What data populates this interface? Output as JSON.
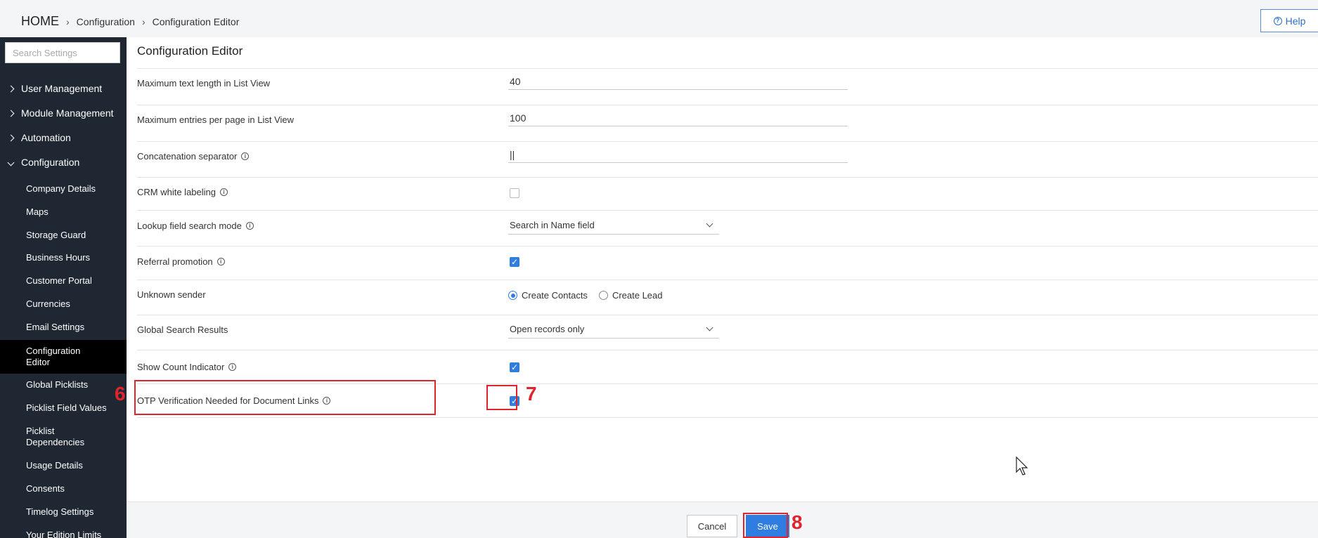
{
  "breadcrumb": {
    "home": "HOME",
    "items": [
      "Configuration",
      "Configuration Editor"
    ]
  },
  "help": {
    "label": "Help"
  },
  "sidebar": {
    "search_placeholder": "Search Settings",
    "groups": [
      {
        "label": "User Management"
      },
      {
        "label": "Module Management"
      },
      {
        "label": "Automation"
      },
      {
        "label": "Configuration"
      }
    ],
    "items": [
      {
        "label": "Company Details"
      },
      {
        "label": "Maps"
      },
      {
        "label": "Storage Guard"
      },
      {
        "label": "Business Hours"
      },
      {
        "label": "Customer Portal"
      },
      {
        "label": "Currencies"
      },
      {
        "label": "Email Settings"
      },
      {
        "label": "Configuration Editor"
      },
      {
        "label": "Global Picklists"
      },
      {
        "label": "Picklist Field Values"
      },
      {
        "label": "Picklist Dependencies"
      },
      {
        "label": "Usage Details"
      },
      {
        "label": "Consents"
      },
      {
        "label": "Timelog Settings"
      },
      {
        "label": "Your Edition Limits"
      }
    ]
  },
  "main": {
    "title": "Configuration Editor",
    "fields": {
      "max_text_length": {
        "label": "Maximum text length in List View",
        "value": "40"
      },
      "max_entries": {
        "label": "Maximum entries per page in List View",
        "value": "100"
      },
      "concat_separator": {
        "label": "Concatenation separator",
        "value": "||"
      },
      "white_labeling": {
        "label": "CRM white labeling",
        "checked": false
      },
      "lookup_mode": {
        "label": "Lookup field search mode",
        "value": "Search in Name field"
      },
      "referral": {
        "label": "Referral promotion",
        "checked": true
      },
      "unknown_sender": {
        "label": "Unknown sender",
        "options": [
          "Create Contacts",
          "Create Lead"
        ],
        "selected": "Create Contacts"
      },
      "global_search": {
        "label": "Global Search Results",
        "value": "Open records only"
      },
      "count_indicator": {
        "label": "Show Count Indicator",
        "checked": true
      },
      "otp": {
        "label": "OTP Verification Needed for Document Links",
        "checked": true
      }
    }
  },
  "footer": {
    "cancel": "Cancel",
    "save": "Save"
  },
  "annotations": {
    "n6": "6",
    "n7": "7",
    "n8": "8"
  },
  "colors": {
    "accent": "#2f7de1",
    "annotation": "#e0242d",
    "sidebar_bg": "#1f2733"
  }
}
